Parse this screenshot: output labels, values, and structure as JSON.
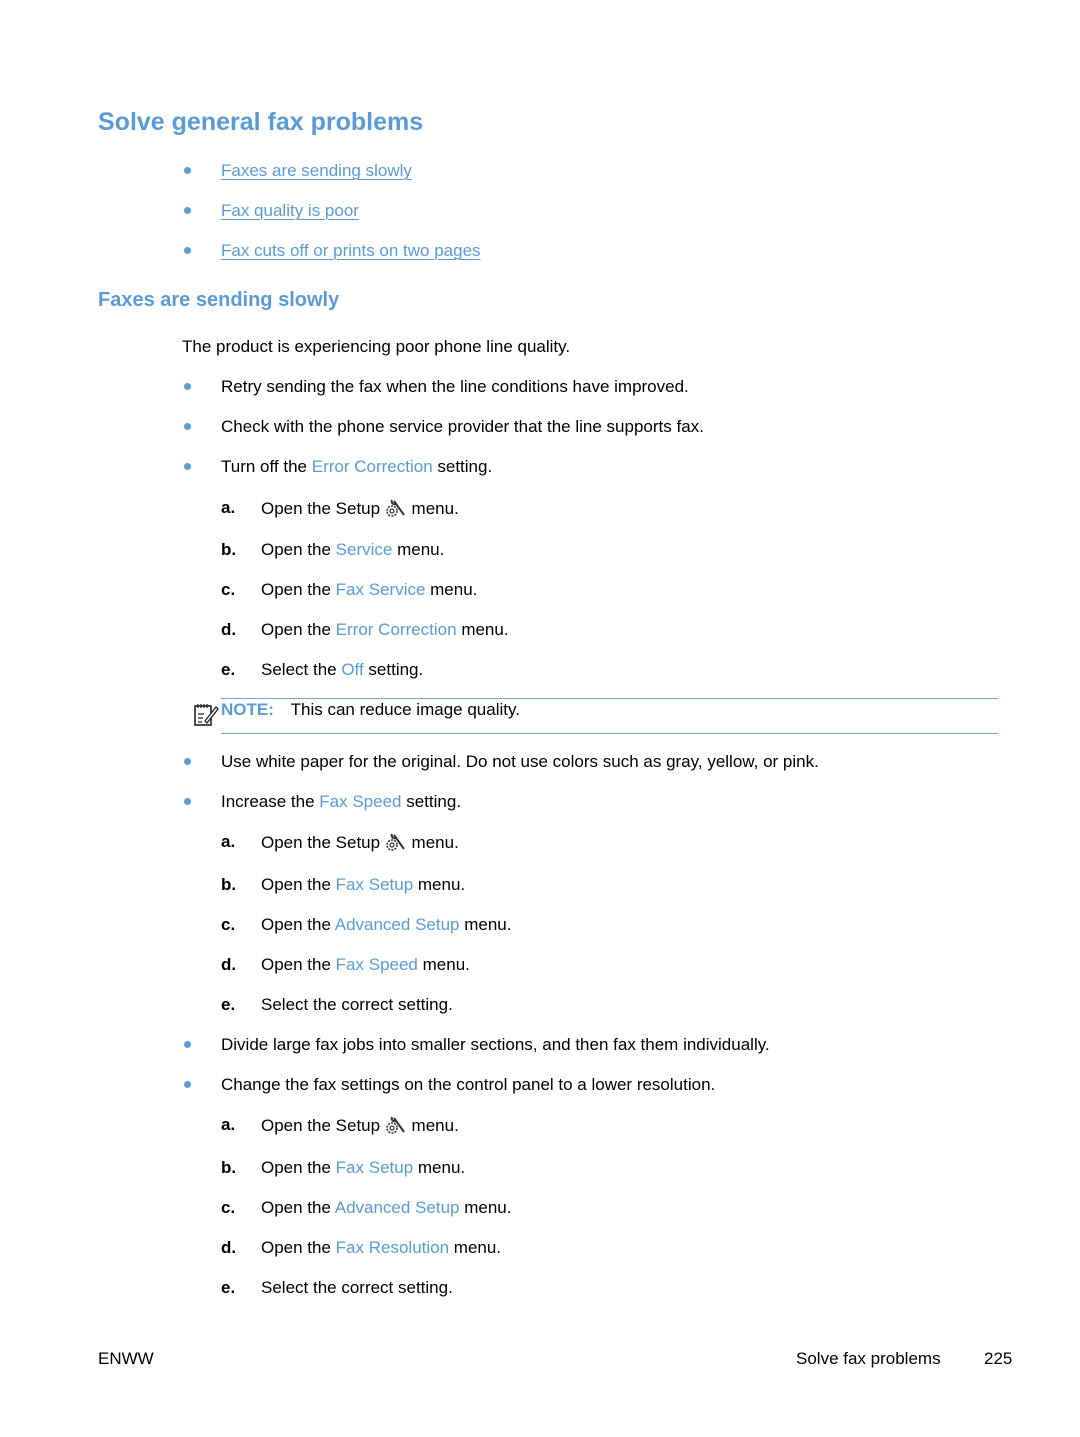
{
  "headings": {
    "main": "Solve general fax problems",
    "section": "Faxes are sending slowly"
  },
  "toc": [
    {
      "label": "Faxes are sending slowly"
    },
    {
      "label": "Fax quality is poor"
    },
    {
      "label": "Fax cuts off or prints on two pages"
    }
  ],
  "intro": "The product is experiencing poor phone line quality.",
  "bullets": {
    "b1": "Retry sending the fax when the line conditions have improved.",
    "b2": "Check with the phone service provider that the line supports fax.",
    "b3": {
      "pre": "Turn off the ",
      "term": "Error Correction",
      "post": " setting."
    },
    "b4": "Use white paper for the original. Do not use colors such as gray, yellow, or pink.",
    "b5": {
      "pre": "Increase the ",
      "term": "Fax Speed",
      "post": " setting."
    },
    "b6": "Divide large fax jobs into smaller sections, and then fax them individually.",
    "b7": "Change the fax settings on the control panel to a lower resolution."
  },
  "steps_group1": [
    {
      "letter": "a.",
      "pre": "Open the Setup ",
      "term": "",
      "post": " menu.",
      "icon": "setup-wrench-gear-icon"
    },
    {
      "letter": "b.",
      "pre": "Open the ",
      "term": "Service",
      "post": " menu."
    },
    {
      "letter": "c.",
      "pre": "Open the ",
      "term": "Fax Service",
      "post": " menu."
    },
    {
      "letter": "d.",
      "pre": "Open the ",
      "term": "Error Correction",
      "post": " menu."
    },
    {
      "letter": "e.",
      "pre": "Select the ",
      "term": "Off",
      "post": " setting."
    }
  ],
  "note": {
    "label": "NOTE:",
    "text": "This can reduce image quality.",
    "icon": "note-pad-icon"
  },
  "steps_group2": [
    {
      "letter": "a.",
      "pre": "Open the Setup ",
      "term": "",
      "post": " menu.",
      "icon": "setup-wrench-gear-icon"
    },
    {
      "letter": "b.",
      "pre": "Open the ",
      "term": "Fax Setup",
      "post": " menu."
    },
    {
      "letter": "c.",
      "pre": "Open the ",
      "term": "Advanced Setup",
      "post": " menu."
    },
    {
      "letter": "d.",
      "pre": "Open the ",
      "term": "Fax Speed",
      "post": " menu."
    },
    {
      "letter": "e.",
      "pre": "Select the correct setting.",
      "term": "",
      "post": ""
    }
  ],
  "steps_group3": [
    {
      "letter": "a.",
      "pre": "Open the Setup ",
      "term": "",
      "post": " menu.",
      "icon": "setup-wrench-gear-icon"
    },
    {
      "letter": "b.",
      "pre": "Open the ",
      "term": "Fax Setup",
      "post": " menu."
    },
    {
      "letter": "c.",
      "pre": "Open the ",
      "term": "Advanced Setup",
      "post": " menu."
    },
    {
      "letter": "d.",
      "pre": "Open the ",
      "term": "Fax Resolution",
      "post": " menu."
    },
    {
      "letter": "e.",
      "pre": "Select the correct setting.",
      "term": "",
      "post": ""
    }
  ],
  "footer": {
    "left": "ENWW",
    "section": "Solve fax problems",
    "page": "225"
  },
  "colors": {
    "accent": "#5b9bd5",
    "rule": "#6fa6d8"
  }
}
